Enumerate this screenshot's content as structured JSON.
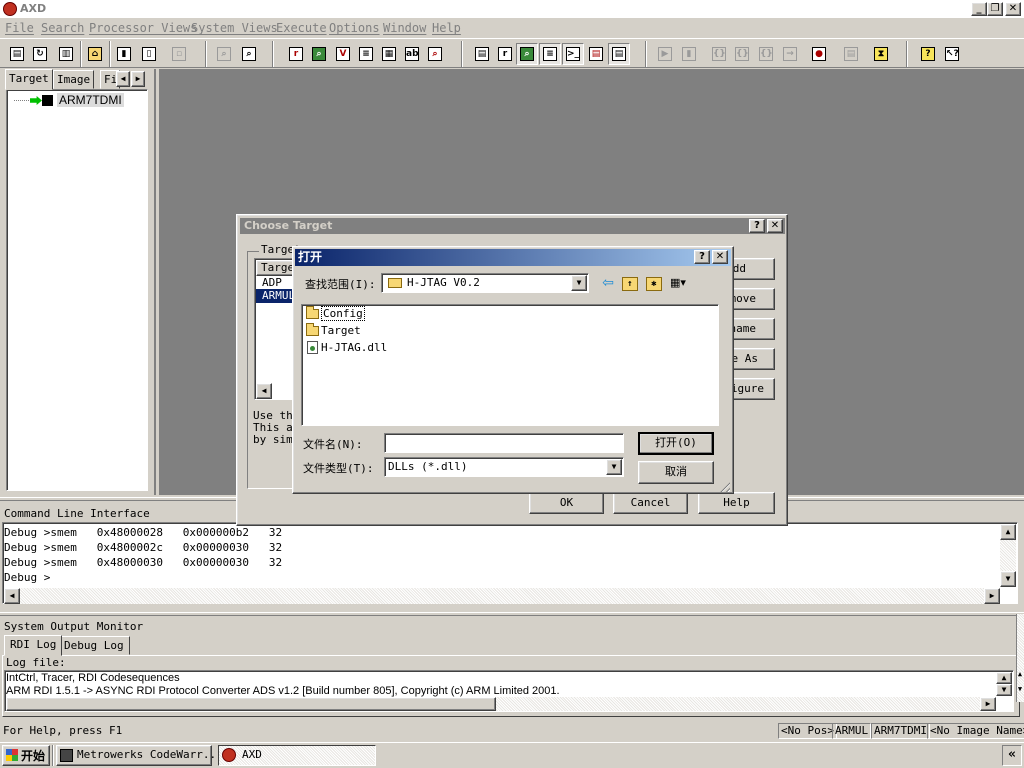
{
  "window": {
    "title": "AXD"
  },
  "menu": [
    "File",
    "Search",
    "Processor Views",
    "System Views",
    "Execute",
    "Options",
    "Window",
    "Help"
  ],
  "left_tabs": [
    "Target",
    "Image",
    "Fi"
  ],
  "tree": {
    "item": "ARM7TDMI"
  },
  "cli": {
    "label": "Command Line Interface",
    "lines": [
      "Debug >smem   0x48000028   0x000000b2   32",
      "Debug >smem   0x4800002c   0x00000030   32",
      "Debug >smem   0x48000030   0x00000030   32",
      "Debug >"
    ]
  },
  "output_monitor": {
    "label": "System Output Monitor",
    "tabs": [
      "RDI Log",
      "Debug Log"
    ],
    "log_label": "Log file:",
    "lines": [
      "IntCtrl, Tracer, RDI Codesequences",
      "ARM RDI 1.5.1 -> ASYNC RDI Protocol Converter ADS v1.2 [Build number 805], Copyright (c) ARM Limited 2001."
    ]
  },
  "status": {
    "help": "For Help, press F1",
    "pos": "<No Pos>",
    "proc": "ARMUL",
    "target": "ARM7TDMI",
    "image": "<No Image Name>"
  },
  "taskbar": {
    "start": "开始",
    "tasks": [
      "Metrowerks CodeWarr...",
      "AXD"
    ],
    "chevron": "«"
  },
  "choose_target": {
    "title": "Choose Target",
    "group": "Target",
    "col_header": "Targe",
    "rows": [
      "ADP",
      "ARMUL"
    ],
    "help_text": [
      "Use th",
      "This a",
      "by sim"
    ],
    "side_buttons": [
      "dd",
      "move",
      "name",
      "e As",
      "igure"
    ],
    "buttons": {
      "ok": "OK",
      "cancel": "Cancel",
      "help": "Help"
    }
  },
  "open_dialog": {
    "title": "打开",
    "look_in_label": "查找范围(I):",
    "look_in_value": "H-JTAG V0.2",
    "files": [
      {
        "name": "Config",
        "type": "folder"
      },
      {
        "name": "Target",
        "type": "folder"
      },
      {
        "name": "H-JTAG.dll",
        "type": "dll"
      }
    ],
    "filename_label": "文件名(N):",
    "filename_value": "",
    "filetype_label": "文件类型(T):",
    "filetype_value": "DLLs (*.dll)",
    "open_button": "打开(O)",
    "cancel_button": "取消"
  }
}
